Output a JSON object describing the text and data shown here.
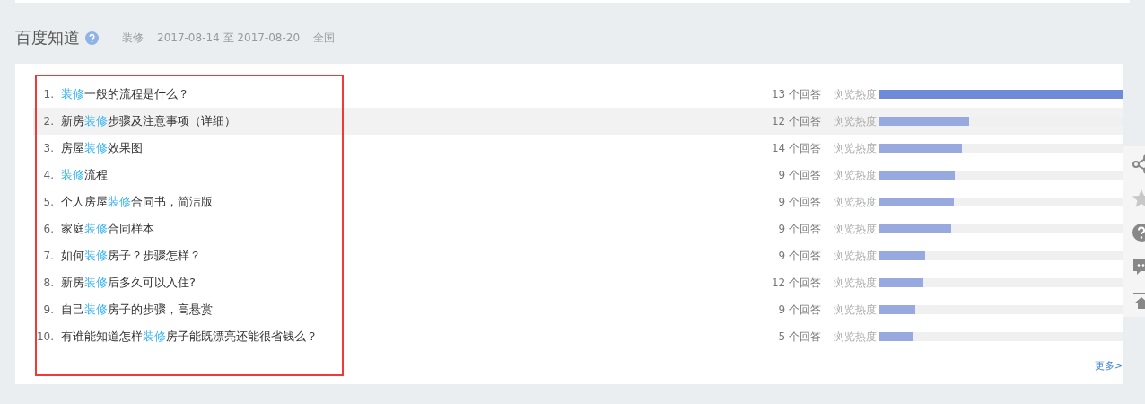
{
  "section": {
    "title": "百度知道",
    "keyword": "装修",
    "date_range": "2017-08-14 至 2017-08-20",
    "region": "全国"
  },
  "questions": [
    {
      "rank": "1.",
      "keyword": "装修",
      "suffix": "一般的流程是什么？",
      "answers": "13 个回答",
      "heat_label": "浏览热度",
      "level": 1.0,
      "color": "#6f8ad6",
      "highlighted": false
    },
    {
      "rank": "2.",
      "prefix": "新房",
      "keyword": "装修",
      "suffix": "步骤及注意事项（详细）",
      "answers": "12 个回答",
      "heat_label": "浏览热度",
      "level": 0.37,
      "color": "#97a9de",
      "highlighted": true
    },
    {
      "rank": "3.",
      "prefix": "房屋",
      "keyword": "装修",
      "suffix": "效果图",
      "answers": "14 个回答",
      "heat_label": "浏览热度",
      "level": 0.34,
      "color": "#97a9de",
      "highlighted": false
    },
    {
      "rank": "4.",
      "keyword": "装修",
      "suffix": "流程",
      "answers": "9 个回答",
      "heat_label": "浏览热度",
      "level": 0.31,
      "color": "#97a9de",
      "highlighted": false
    },
    {
      "rank": "5.",
      "prefix": "个人房屋",
      "keyword": "装修",
      "suffix": "合同书，简洁版",
      "answers": "9 个回答",
      "heat_label": "浏览热度",
      "level": 0.306,
      "color": "#97a9de",
      "highlighted": false
    },
    {
      "rank": "6.",
      "prefix": "家庭",
      "keyword": "装修",
      "suffix": "合同样本",
      "answers": "9 个回答",
      "heat_label": "浏览热度",
      "level": 0.295,
      "color": "#97a9de",
      "highlighted": false
    },
    {
      "rank": "7.",
      "prefix": "如何",
      "keyword": "装修",
      "suffix": "房子？步骤怎样？",
      "answers": "9 个回答",
      "heat_label": "浏览热度",
      "level": 0.19,
      "color": "#97a9de",
      "highlighted": false
    },
    {
      "rank": "8.",
      "prefix": "新房",
      "keyword": "装修",
      "suffix": "后多久可以入住?",
      "answers": "12 个回答",
      "heat_label": "浏览热度",
      "level": 0.18,
      "color": "#97a9de",
      "highlighted": false
    },
    {
      "rank": "9.",
      "prefix": "自己",
      "keyword": "装修",
      "suffix": "房子的步骤，高悬赏",
      "answers": "9 个回答",
      "heat_label": "浏览热度",
      "level": 0.148,
      "color": "#97a9de",
      "highlighted": false
    },
    {
      "rank": "10.",
      "prefix": "有谁能知道怎样",
      "keyword": "装修",
      "suffix": "房子能既漂亮还能很省钱么？",
      "answers": "5 个回答",
      "heat_label": "浏览热度",
      "level": 0.137,
      "color": "#97a9de",
      "highlighted": false
    }
  ],
  "more_link": "更多>"
}
